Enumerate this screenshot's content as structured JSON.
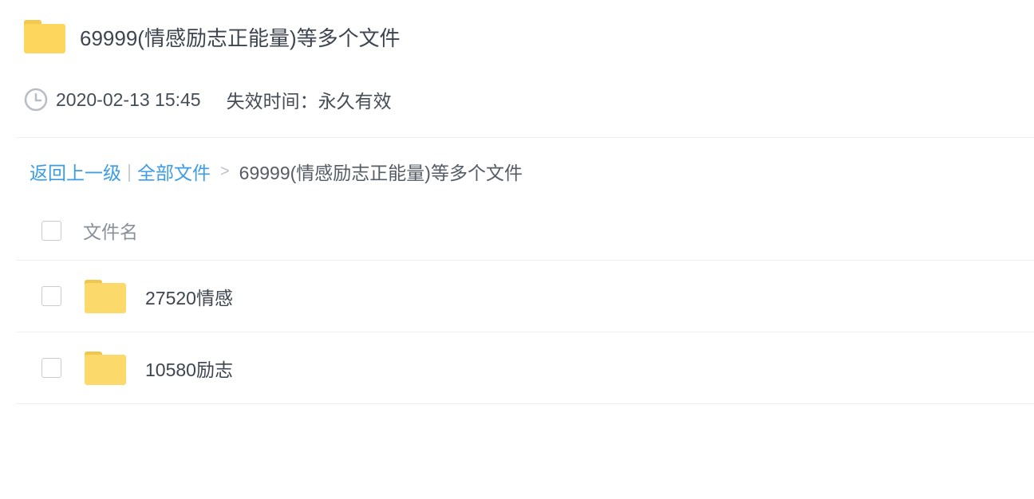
{
  "header": {
    "title": "69999(情感励志正能量)等多个文件",
    "folder_icon": "folder-icon"
  },
  "meta": {
    "date": "2020-02-13 15:45",
    "expiry": "失效时间：永久有效",
    "clock_icon": "clock-icon"
  },
  "breadcrumb": {
    "back": "返回上一级",
    "separator": "|",
    "all_files": "全部文件",
    "arrow": ">",
    "current": "69999(情感励志正能量)等多个文件"
  },
  "list": {
    "column_header": "文件名",
    "items": [
      {
        "name": "27520情感",
        "icon": "folder-icon"
      },
      {
        "name": "10580励志",
        "icon": "folder-icon"
      }
    ]
  },
  "colors": {
    "folder": "#fcd65d",
    "link": "#3c9ce6",
    "divider": "#eef0f3"
  }
}
